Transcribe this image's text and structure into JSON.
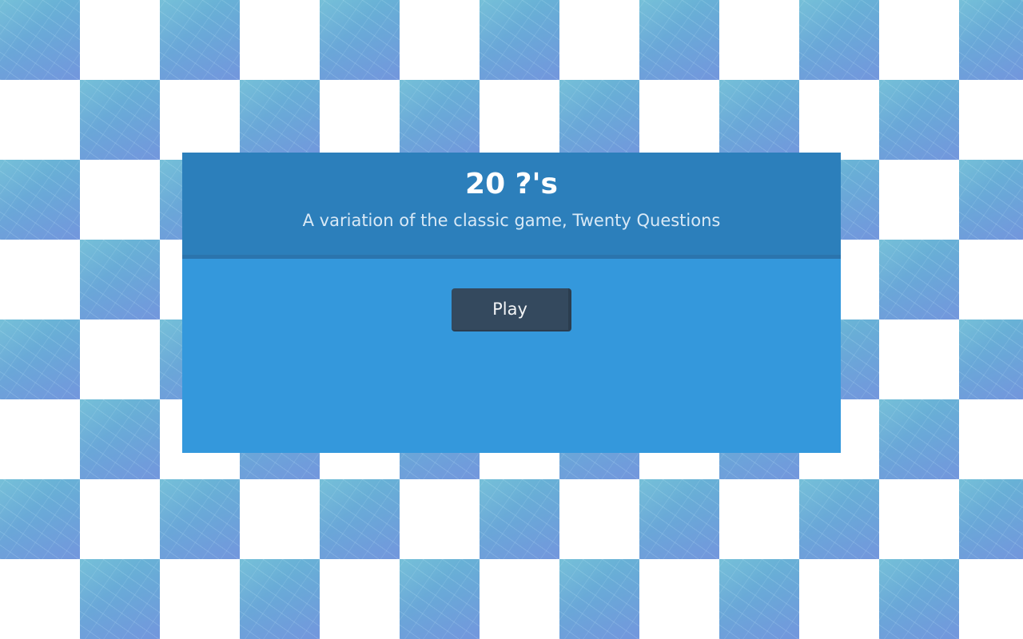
{
  "game": {
    "title": "20 ?'s",
    "subtitle": "A variation of the classic game, Twenty Questions",
    "play_label": "Play"
  },
  "colors": {
    "card_body": "#3498dc",
    "card_header": "#2c7fbb",
    "button": "#34495e",
    "tile": "#6aa7d8",
    "background": "#ffffff"
  },
  "icons": {
    "background_tile": "scratched-blue-tile"
  }
}
